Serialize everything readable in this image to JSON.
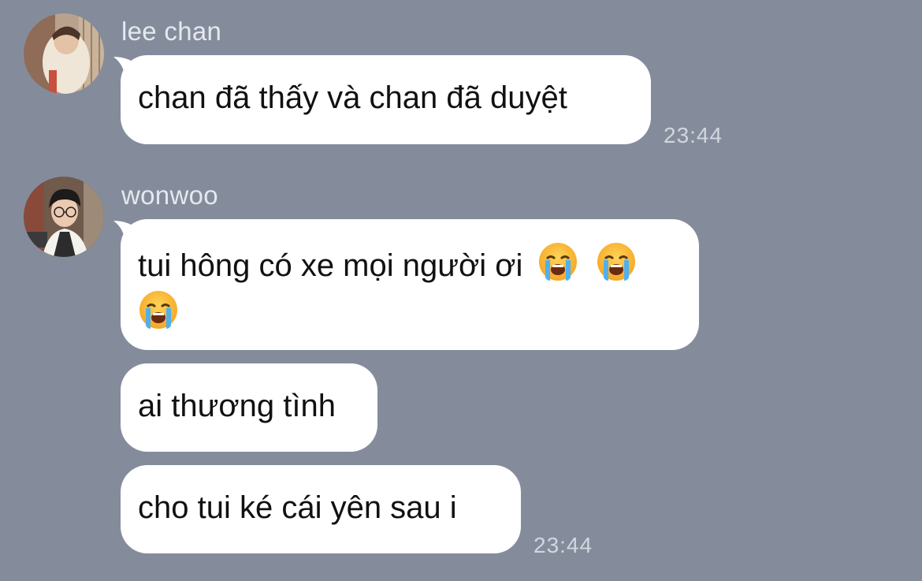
{
  "colors": {
    "background": "#848c9c",
    "bubble": "#ffffff",
    "text": "#111111",
    "meta_text": "#d2d6de"
  },
  "messages": [
    {
      "sender": "lee chan",
      "avatar_icon": "avatar-photo",
      "bubbles": [
        "chan đã thấy và chan đã duyệt"
      ],
      "time": "23:44"
    },
    {
      "sender": "wonwoo",
      "avatar_icon": "avatar-photo",
      "bubbles": [
        {
          "text": "tui hông có xe mọi người ơi",
          "emojis": [
            "loudly-crying-face",
            "loudly-crying-face",
            "loudly-crying-face"
          ]
        },
        "ai thương tình",
        "cho tui ké cái yên sau i"
      ],
      "time": "23:44"
    }
  ]
}
